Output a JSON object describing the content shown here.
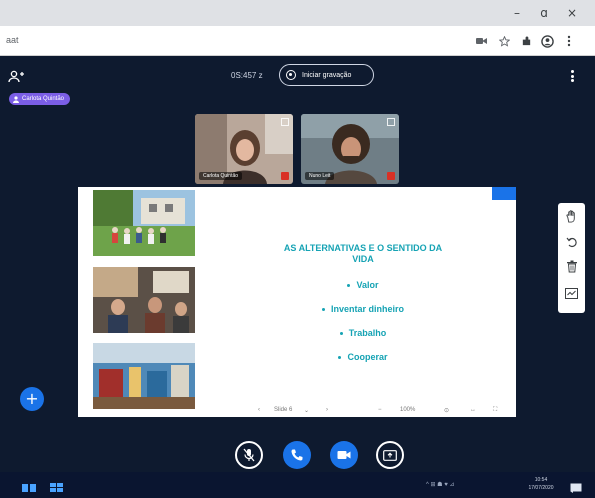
{
  "browser": {
    "url": "aat",
    "window_controls": [
      "–",
      "ɑ",
      "×"
    ]
  },
  "meeting": {
    "timer": "0S:457 z",
    "record_label": "Iniciar gravação",
    "presenter_name": "Carlota Quintão"
  },
  "participants": [
    {
      "name": "Carlota Quintão"
    },
    {
      "name": "Nuno Leit"
    }
  ],
  "slide": {
    "title_line1": "AS ALTERNATIVAS E O SENTIDO DA",
    "title_line2": "VIDA",
    "bullets": [
      "Valor",
      "Inventar dinheiro",
      "Trabalho",
      "Cooperar"
    ],
    "accent": "#16a3b4"
  },
  "slide_nav": {
    "prev": "‹",
    "page": "Slide 6",
    "dropdown": "⌄",
    "next": "›",
    "zoom_out": "−",
    "zoom_label": "100%",
    "fit": "⊙",
    "width": "↔",
    "fullscreen": "⛶"
  },
  "taskbar": {
    "time": "10:54",
    "date": "17/07/2020",
    "tray": "^ ⊞ ☗ ♥ ⊿"
  },
  "colors": {
    "app_bg": "#0e1a2f",
    "primary": "#1a73e8",
    "presenter_chip": "#7b5ee6"
  }
}
